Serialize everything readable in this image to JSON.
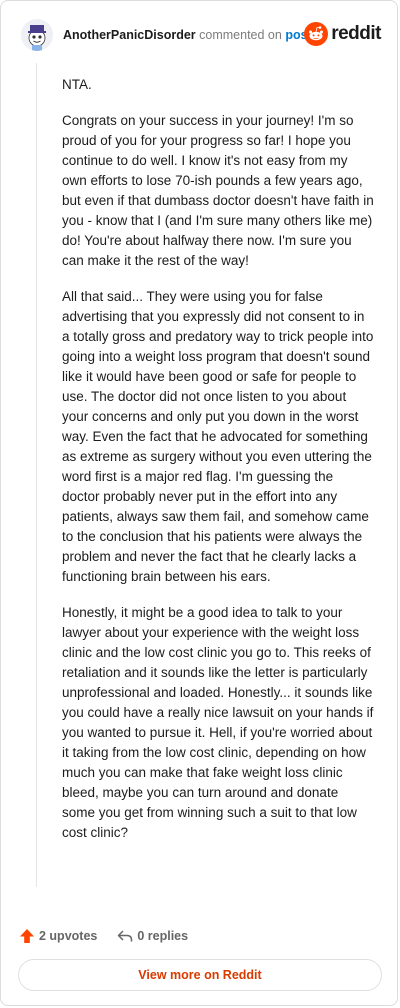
{
  "header": {
    "username": "AnotherPanicDisorder",
    "action_text": "commented on",
    "post_link": "post",
    "logo_text": "reddit",
    "brand_color": "#ff4500"
  },
  "comment": {
    "paragraphs": [
      "NTA.",
      "Congrats on your success in your journey! I'm so proud of you for your progress so far! I hope you continue to do well. I know it's not easy from my own efforts to lose 70-ish pounds a few years ago, but even if that dumbass doctor doesn't have faith in you - know that I (and I'm sure many others like me) do! You're about halfway there now. I'm sure you can make it the rest of the way!",
      "All that said... They were using you for false advertising that you expressly did not consent to in a totally gross and predatory way to trick people into going into a weight loss program that doesn't sound like it would have been good or safe for people to use. The doctor did not once listen to you about your concerns and only put you down in the worst way. Even the fact that he advocated for something as extreme as surgery without you even uttering the word first is a major red flag. I'm guessing the doctor probably never put in the effort into any patients, always saw them fail, and somehow came to the conclusion that his patients were always the problem and never the fact that he clearly lacks a functioning brain between his ears.",
      "Honestly, it might be a good idea to talk to your lawyer about your experience with the weight loss clinic and the low cost clinic you go to. This reeks of retaliation and it sounds like the letter is particularly unprofessional and loaded. Honestly... it sounds like you could have a really nice lawsuit on your hands if you wanted to pursue it. Hell, if you're worried about it taking from the low cost clinic, depending on how much you can make that fake weight loss clinic bleed, maybe you can turn around and donate some you get from winning such a suit to that low cost clinic?"
    ]
  },
  "footer": {
    "upvotes": "2 upvotes",
    "replies": "0 replies",
    "upvote_color": "#ff4500"
  },
  "view_more": {
    "label": "View more on Reddit",
    "color": "#d93a00"
  }
}
